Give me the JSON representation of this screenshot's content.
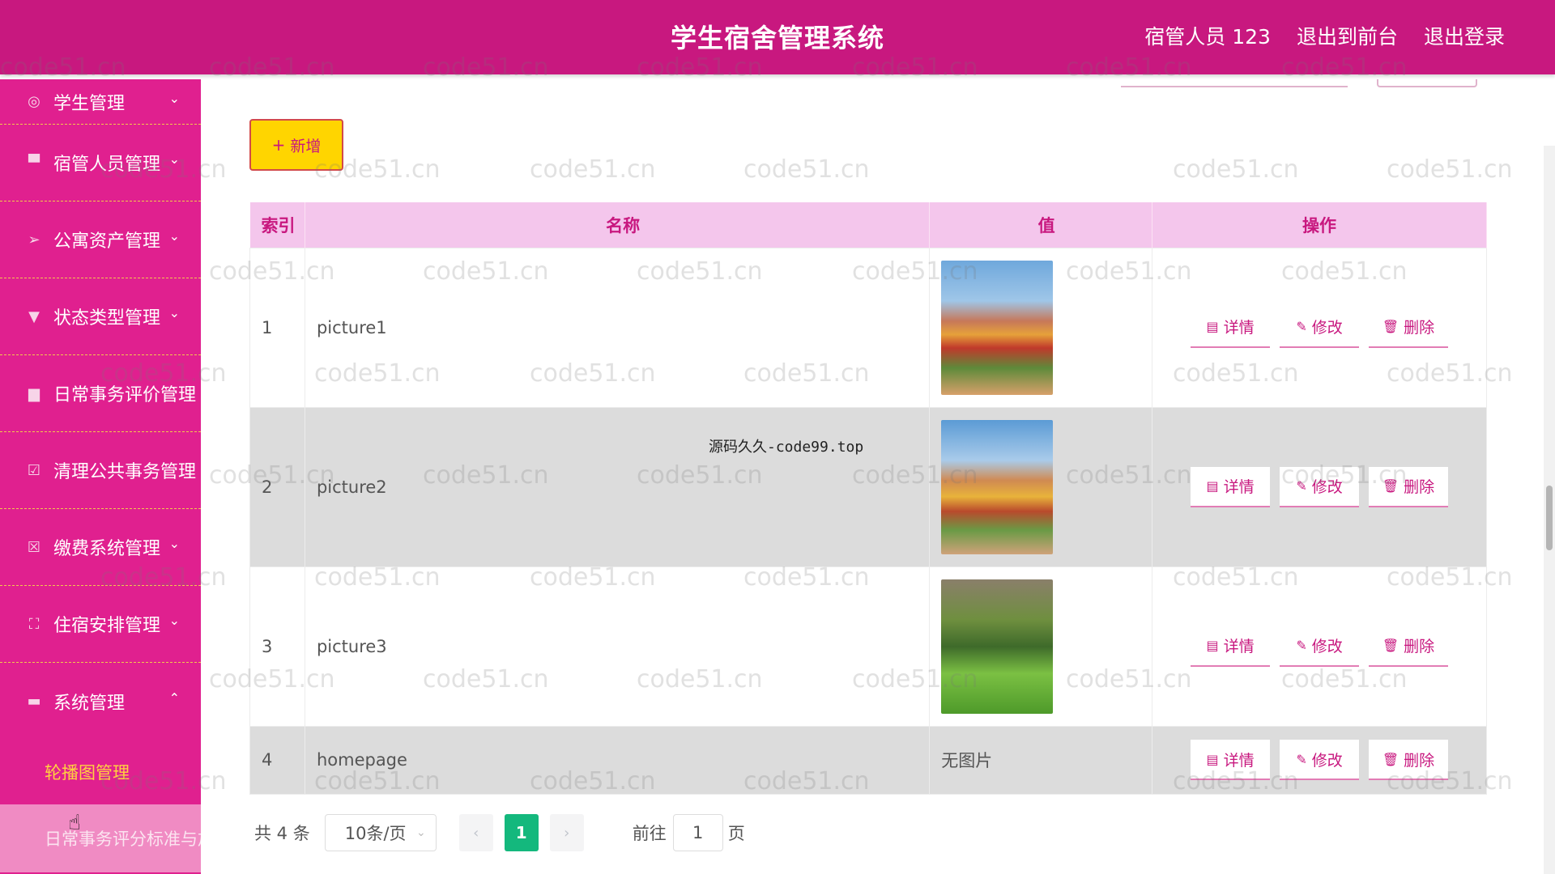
{
  "header": {
    "title": "学生宿舍管理系统",
    "user": "宿管人员 123",
    "to_front": "退出到前台",
    "logout": "退出登录"
  },
  "sidebar": {
    "items": [
      {
        "label": "学生管理",
        "icon": "user-icon",
        "expanded": false
      },
      {
        "label": "宿管人员管理",
        "icon": "monitor-icon",
        "expanded": false
      },
      {
        "label": "公寓资产管理",
        "icon": "send-icon",
        "expanded": false
      },
      {
        "label": "状态类型管理",
        "icon": "flag-icon",
        "expanded": false
      },
      {
        "label": "日常事务评价管理",
        "icon": "board-icon",
        "expanded": false
      },
      {
        "label": "清理公共事务管理",
        "icon": "check-icon",
        "expanded": false
      },
      {
        "label": "缴费系统管理",
        "icon": "trash-icon",
        "expanded": false
      },
      {
        "label": "住宿安排管理",
        "icon": "frame-icon",
        "expanded": false
      },
      {
        "label": "系统管理",
        "icon": "chat-icon",
        "expanded": true
      }
    ],
    "sub_items": [
      {
        "label": "轮播图管理",
        "active": true
      },
      {
        "label": "日常事务评分标准与加",
        "active": false
      }
    ]
  },
  "toolbar": {
    "add_label": "新增"
  },
  "table": {
    "headers": [
      "索引",
      "名称",
      "值",
      "操作"
    ],
    "rows": [
      {
        "index": "1",
        "name": "picture1",
        "value": "image"
      },
      {
        "index": "2",
        "name": "picture2",
        "value": "image"
      },
      {
        "index": "3",
        "name": "picture3",
        "value": "image"
      },
      {
        "index": "4",
        "name": "homepage",
        "value": "无图片"
      }
    ],
    "actions": {
      "detail": "详情",
      "edit": "修改",
      "delete": "删除"
    }
  },
  "pagination": {
    "total_text": "共 4 条",
    "page_size": "10条/页",
    "current_page": "1",
    "goto_label": "前往",
    "goto_value": "1",
    "page_suffix": "页"
  },
  "watermark": {
    "text": "code51.cn",
    "overlay": "源码久久-code99.top"
  },
  "colors": {
    "header_bg": "#c8187f",
    "sidebar_bg": "#e0208f",
    "table_header_bg": "#f4c6ec",
    "add_button_bg": "#ffd500",
    "active_submenu": "#ffd23f",
    "page_active": "#14b87d"
  }
}
